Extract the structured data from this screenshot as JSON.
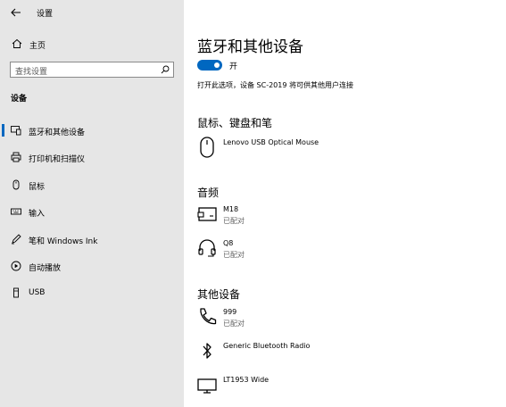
{
  "window": {
    "title": "设置",
    "back_icon": "arrow-left-icon"
  },
  "sidebar": {
    "home_label": "主页",
    "search_placeholder": "查找设置",
    "section_title": "设备",
    "items": [
      {
        "label": "蓝牙和其他设备",
        "icon": "bluetooth-devices-icon",
        "selected": true
      },
      {
        "label": "打印机和扫描仪",
        "icon": "printer-icon",
        "selected": false
      },
      {
        "label": "鼠标",
        "icon": "mouse-icon",
        "selected": false
      },
      {
        "label": "输入",
        "icon": "keyboard-icon",
        "selected": false
      },
      {
        "label": "笔和 Windows Ink",
        "icon": "pen-icon",
        "selected": false
      },
      {
        "label": "自动播放",
        "icon": "autoplay-icon",
        "selected": false
      },
      {
        "label": "USB",
        "icon": "usb-icon",
        "selected": false
      }
    ]
  },
  "main": {
    "title": "蓝牙和其他设备",
    "bluetooth_toggle": {
      "state": "on",
      "label": "开"
    },
    "description": "打开此选项，设备 SC-2019 将可供其他用户连接",
    "groups": [
      {
        "title": "鼠标、键盘和笔",
        "devices": [
          {
            "name": "Lenovo USB Optical Mouse",
            "status": "",
            "icon": "mouse-icon"
          }
        ]
      },
      {
        "title": "音频",
        "devices": [
          {
            "name": "M18",
            "status": "已配对",
            "icon": "audio-device-icon"
          },
          {
            "name": "Q8",
            "status": "已配对",
            "icon": "headset-icon"
          }
        ]
      },
      {
        "title": "其他设备",
        "devices": [
          {
            "name": "999",
            "status": "已配对",
            "icon": "phone-icon"
          },
          {
            "name": "Generic Bluetooth Radio",
            "status": "",
            "icon": "bluetooth-icon"
          },
          {
            "name": "LT1953 Wide",
            "status": "",
            "icon": "monitor-icon"
          }
        ]
      }
    ]
  },
  "colors": {
    "accent": "#0067c0",
    "sidebar_bg": "#e6e6e6",
    "content_bg": "#ffffff"
  }
}
